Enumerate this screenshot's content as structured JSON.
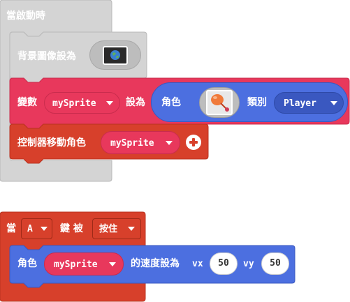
{
  "colors": {
    "disabled_fill": "#d4d4d4",
    "disabled_stroke": "#b8b8b8",
    "pink": "#e8385c",
    "pink_dark": "#c92c4d",
    "red_orange": "#d7402b",
    "red_orange_dark": "#b8321f",
    "blue": "#4c6fe0",
    "blue_dark": "#3a58c0"
  },
  "on_start": {
    "label": "當啟動時",
    "set_background": {
      "label": "背景圖像設為",
      "image_icon": "earth-image-icon"
    },
    "set_variable": {
      "label": "變數",
      "variable": "mySprite",
      "to_label": "設為",
      "sprite_block": {
        "label": "角色",
        "image_icon": "balloon-sprite-icon",
        "kind_label": "類別",
        "kind_value": "Player"
      }
    },
    "move_with_buttons": {
      "label": "控制器移動角色",
      "sprite_var": "mySprite",
      "plus_icon": "plus-icon"
    }
  },
  "on_button": {
    "label_when": "當",
    "button": "A",
    "label_key": "鍵 被",
    "event": "按住",
    "set_velocity": {
      "label_sprite": "角色",
      "sprite_var": "mySprite",
      "label_velocity": "的速度設為",
      "vx_label": "vx",
      "vx": "50",
      "vy_label": "vy",
      "vy": "50"
    }
  }
}
